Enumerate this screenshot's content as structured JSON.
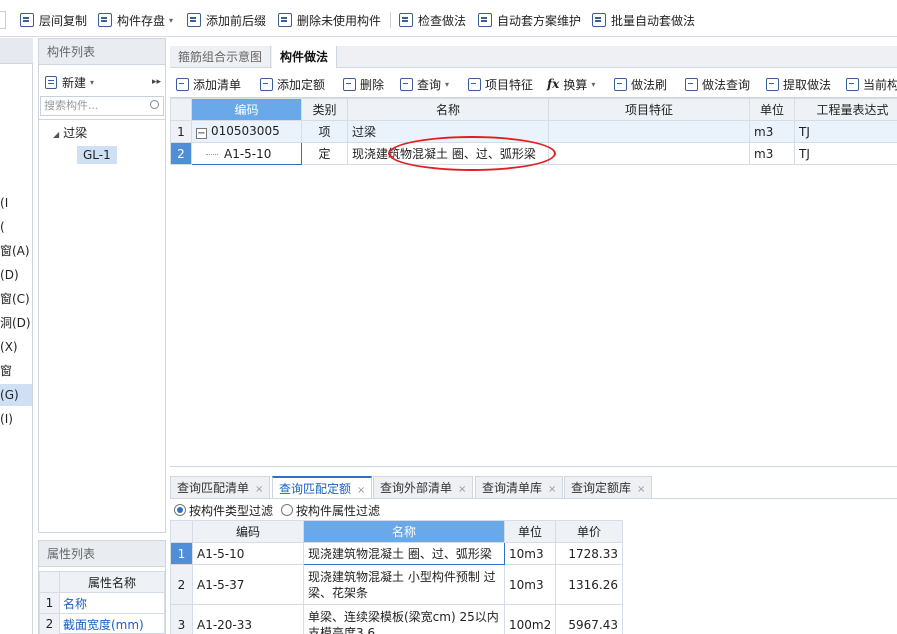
{
  "toolbar": {
    "items": [
      {
        "label": "层间复制",
        "icon": "copy-floor-icon"
      },
      {
        "label": "构件存盘",
        "icon": "save-component-icon",
        "caret": "▾"
      },
      {
        "label": "添加前后缀",
        "icon": "add-affix-icon"
      },
      {
        "label": "删除未使用构件",
        "icon": "delete-unused-icon"
      },
      {
        "label": "检查做法",
        "icon": "check-method-icon"
      },
      {
        "label": "自动套方案维护",
        "icon": "auto-scheme-icon"
      },
      {
        "label": "批量自动套做法",
        "icon": "batch-auto-icon"
      }
    ]
  },
  "left_pane": {
    "items": [
      "I)",
      ")",
      "窗(A)",
      "(D)",
      "窗(C)",
      "洞(D)",
      "(X)",
      "窗",
      "(G)",
      "(I)"
    ],
    "selected_index": 8
  },
  "component_list": {
    "title": "构件列表",
    "new_label": "新建",
    "new_caret": "▾",
    "more": "▸▸",
    "search_placeholder": "搜索构件...",
    "tree_root": "过梁",
    "tree_leaf": "GL-1"
  },
  "property_list": {
    "title": "属性列表",
    "header": "属性名称",
    "rows": [
      {
        "num": "1",
        "name": "名称"
      },
      {
        "num": "2",
        "name": "截面宽度(mm)"
      }
    ]
  },
  "main_tabs": [
    {
      "label": "箍筋组合示意图",
      "active": false
    },
    {
      "label": "构件做法",
      "active": true
    }
  ],
  "main_toolbar": [
    {
      "label": "添加清单"
    },
    {
      "label": "添加定额"
    },
    {
      "label": "删除"
    },
    {
      "label": "查询",
      "caret": "▾"
    },
    {
      "label": "项目特征"
    },
    {
      "label": "换算",
      "caret": "▾",
      "icon_text": "fx"
    },
    {
      "label": "做法刷"
    },
    {
      "label": "做法查询"
    },
    {
      "label": "提取做法"
    },
    {
      "label": "当前构"
    }
  ],
  "method_grid": {
    "headers": [
      "编码",
      "类别",
      "名称",
      "项目特征",
      "单位",
      "工程量表达式"
    ],
    "rows": [
      {
        "num": "1",
        "expand": "−",
        "code": "010503005",
        "category": "项",
        "name": "过梁",
        "feature": "",
        "unit": "m3",
        "expr": "TJ"
      },
      {
        "num": "2",
        "code": "A1-5-10",
        "category": "定",
        "name": "现浇建筑物混凝土 圈、过、弧形梁",
        "feature": "",
        "unit": "m3",
        "expr": "TJ"
      }
    ]
  },
  "bottom_tabs": [
    {
      "label": "查询匹配清单",
      "active": false
    },
    {
      "label": "查询匹配定额",
      "active": true
    },
    {
      "label": "查询外部清单",
      "active": false
    },
    {
      "label": "查询清单库",
      "active": false
    },
    {
      "label": "查询定额库",
      "active": false
    }
  ],
  "filters": {
    "by_type": "按构件类型过滤",
    "by_attr": "按构件属性过滤"
  },
  "query_grid": {
    "headers": [
      "编码",
      "名称",
      "单位",
      "单价"
    ],
    "rows": [
      {
        "num": "1",
        "code": "A1-5-10",
        "name": "现浇建筑物混凝土 圈、过、弧形梁",
        "unit": "10m3",
        "price": "1728.33"
      },
      {
        "num": "2",
        "code": "A1-5-37",
        "name_line1": "现浇建筑物混凝土 小型构件预制 过",
        "name_line2": "梁、花架条",
        "unit": "10m3",
        "price": "1316.26"
      },
      {
        "num": "3",
        "code": "A1-20-33",
        "name_line1": "单梁、连续梁模板(梁宽cm) 25以内",
        "name_line2": "支模高度3.6",
        "unit": "100m2",
        "price": "5967.43"
      }
    ]
  }
}
